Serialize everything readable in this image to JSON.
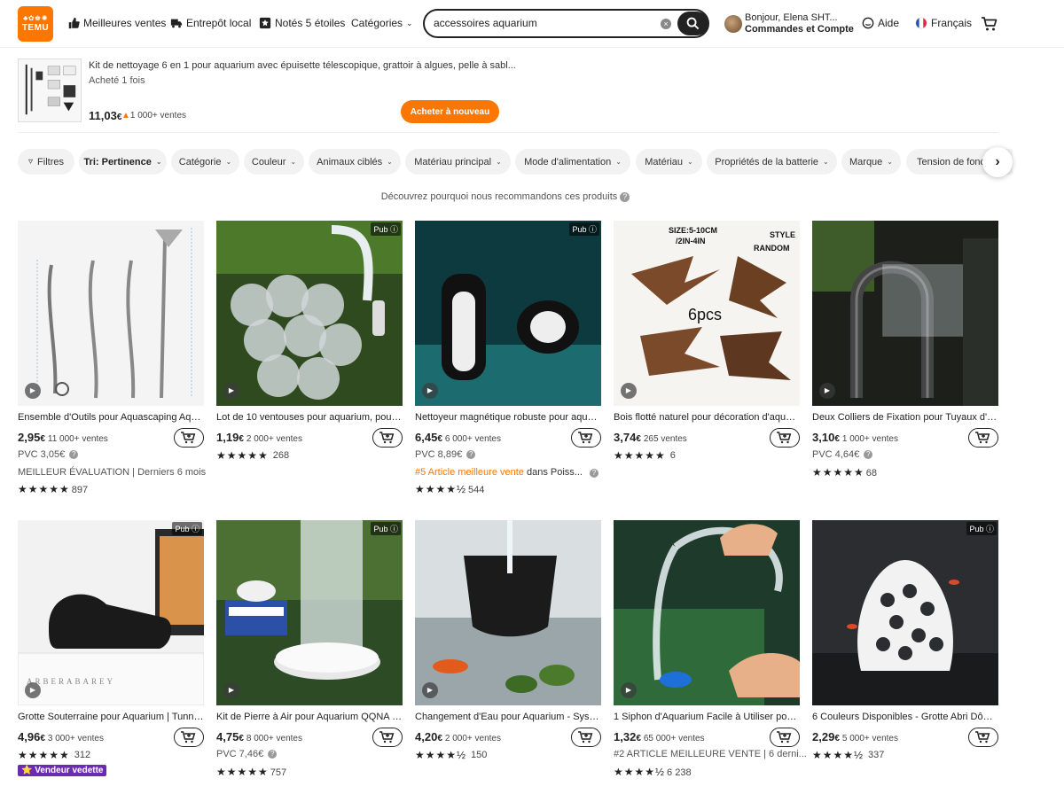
{
  "header": {
    "logo_top": "♣✿♚✺",
    "logo_bottom": "TEMU",
    "nav": [
      "Meilleures ventes",
      "Entrepôt local",
      "Notés 5 étoiles",
      "Catégories"
    ],
    "search_value": "accessoires aquarium",
    "greeting": "Bonjour, Elena SHT...",
    "orders": "Commandes et Compte",
    "help": "Aide",
    "language": "Français"
  },
  "recent": {
    "title": "Kit de nettoyage 6 en 1 pour aquarium avec épuisette télescopique, grattoir à algues, pelle à sabl...",
    "bought": "Acheté 1 fois",
    "price_main": "11,03",
    "price_unit": "€",
    "sold": "1 000+ ventes",
    "buy_again": "Acheter à nouveau"
  },
  "filters": [
    "Filtres",
    "Tri: Pertinence",
    "Catégorie",
    "Couleur",
    "Animaux ciblés",
    "Matériau principal",
    "Mode d'alimentation",
    "Matériau",
    "Propriétés de la batterie",
    "Marque",
    "Tension de fonc"
  ],
  "reco": "Découvrez pourquoi nous recommandons ces produits",
  "pub_label": "Pub",
  "products": [
    {
      "title": "Ensemble d'Outils pour Aquascaping Aqua...",
      "price": "2,95",
      "unit": "€",
      "sold": "11 000+ ventes",
      "line3": "PVC 3,05€",
      "line4_orange": "MEILLEUR ÉVALUATION | Derniers 6 mois",
      "line4_rest": "",
      "stars": "★★★★★",
      "reviews": "897"
    },
    {
      "title": "Lot de 10 ventouses pour aquarium, pour t...",
      "price": "1,19",
      "unit": "€",
      "sold": "2 000+ ventes",
      "stars": "★★★★★",
      "reviews": "268"
    },
    {
      "title": "Nettoyeur magnétique robuste pour aquar...",
      "price": "6,45",
      "unit": "€",
      "sold": "6 000+ ventes",
      "line3": "PVC 8,89€",
      "line4_orange": "#5 Article meilleure vente",
      "line4_rest": " dans Poiss...",
      "stars": "★★★★½",
      "reviews": "544"
    },
    {
      "title": "Bois flotté naturel pour décoration d'aquar...",
      "price": "3,74",
      "unit": "€",
      "sold": "265 ventes",
      "stars": "★★★★★",
      "reviews": "6"
    },
    {
      "title": "Deux Colliers de Fixation pour Tuyaux d'Aq...",
      "price": "3,10",
      "unit": "€",
      "sold": "1 000+ ventes",
      "line3": "PVC 4,64€",
      "stars": "★★★★★",
      "reviews": "68"
    },
    {
      "title": "Grotte Souterraine pour Aquarium | Tunnel...",
      "price": "4,96",
      "unit": "€",
      "sold": "3 000+ ventes",
      "stars": "★★★★★",
      "reviews": "312",
      "badge": "⭐ Vendeur vedette"
    },
    {
      "title": "Kit de Pierre à Air pour Aquarium QQNA - ...",
      "price": "4,75",
      "unit": "€",
      "sold": "8 000+ ventes",
      "line3": "PVC 7,46€",
      "stars": "★★★★★",
      "reviews": "757"
    },
    {
      "title": "Changement d'Eau pour Aquarium - Systè...",
      "price": "4,20",
      "unit": "€",
      "sold": "2 000+ ventes",
      "stars": "★★★★½",
      "reviews": "150"
    },
    {
      "title": "1 Siphon d'Aquarium Facile à Utiliser pour ...",
      "price": "1,32",
      "unit": "€",
      "sold": "65 000+ ventes",
      "line3_orange": "#2 ARTICLE MEILLEURE VENTE | 6 derni...",
      "stars": "★★★★½",
      "reviews": "6 238"
    },
    {
      "title": "6 Couleurs Disponibles - Grotte Abri Dôme...",
      "price": "2,29",
      "unit": "€",
      "sold": "5 000+ ventes",
      "stars": "★★★★½",
      "reviews": "337"
    }
  ],
  "colors": {
    "accent": "#fb7701",
    "badge": "#6b2bb0"
  }
}
